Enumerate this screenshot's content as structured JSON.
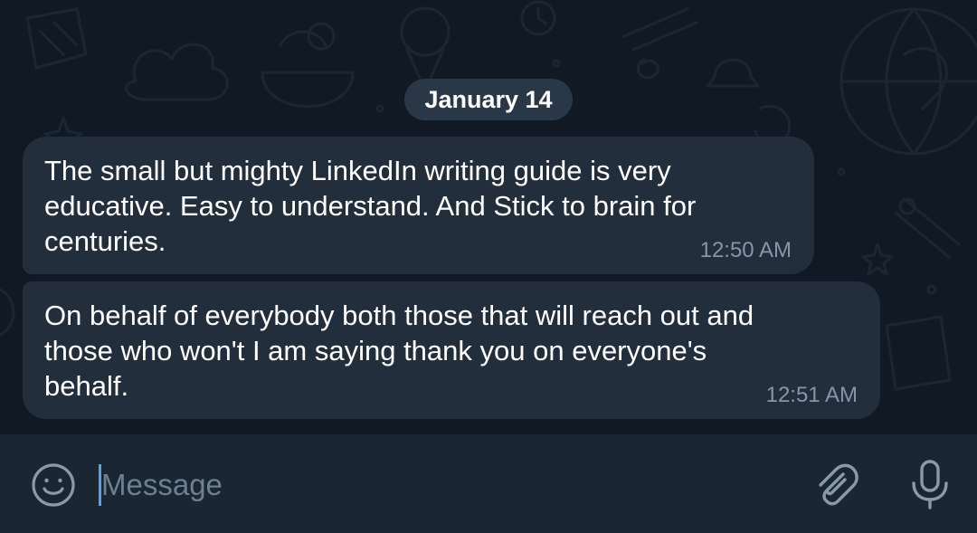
{
  "chat": {
    "date_label": "January 14",
    "messages": [
      {
        "text": "The small but mighty LinkedIn writing guide is very\neducative. Easy to understand. And Stick to brain for\ncenturies.",
        "time": "12:50 AM"
      },
      {
        "text": "On behalf of everybody both those that will reach out and\nthose who won't I am saying thank you on everyone's\nbehalf.",
        "time": "12:51 AM"
      }
    ]
  },
  "composer": {
    "placeholder": "Message",
    "value": "",
    "icons": {
      "emoji": "smile-icon",
      "attach": "paperclip-icon",
      "voice": "microphone-icon"
    }
  },
  "colors": {
    "background": "#0e1621",
    "bubble": "#232e3c",
    "input_bar": "#1b2633",
    "caret": "#5aa0e6",
    "time_text": "#8596a8",
    "icon": "#8a99a9"
  }
}
